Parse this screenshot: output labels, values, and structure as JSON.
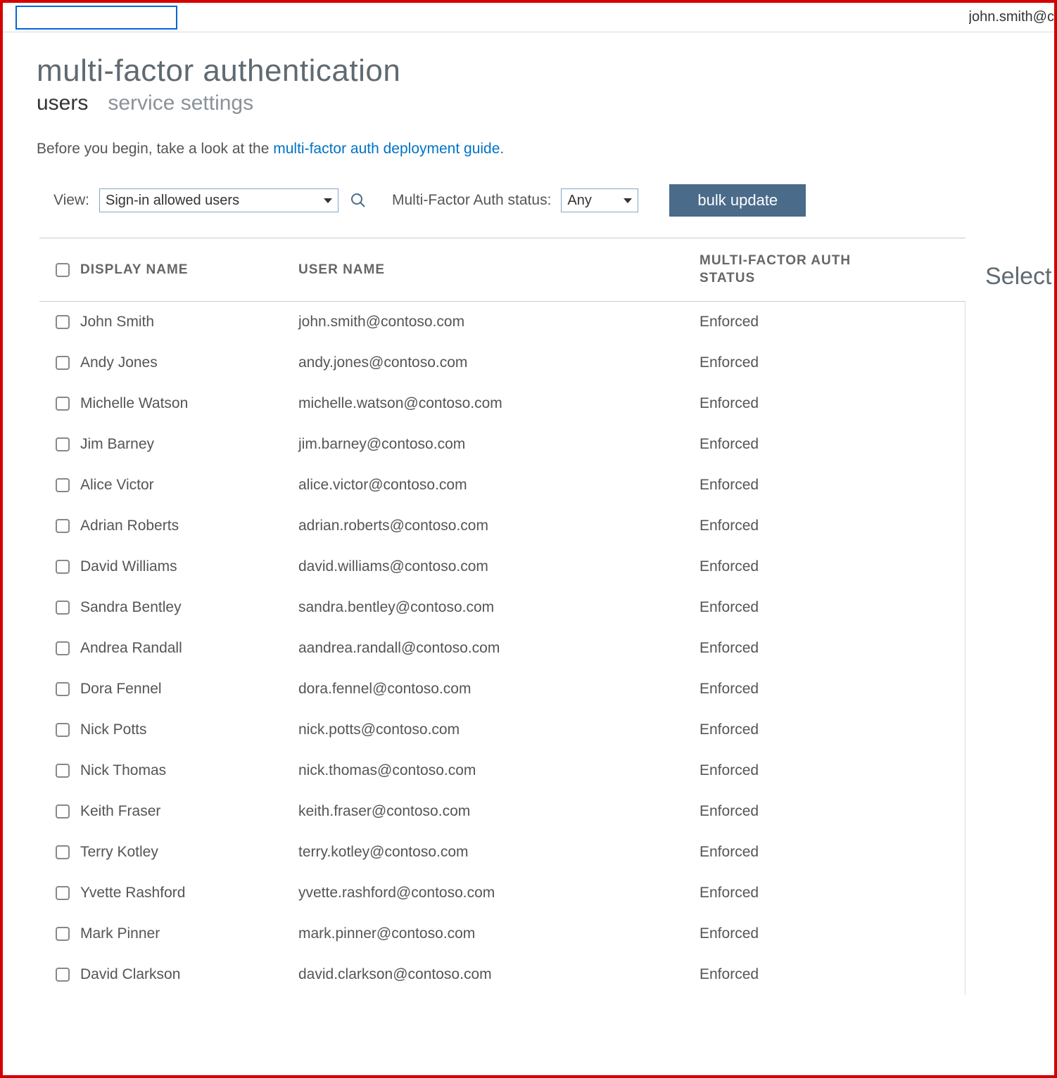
{
  "header": {
    "user_partial": "john.smith@c"
  },
  "page": {
    "title": "multi-factor authentication",
    "tabs": {
      "users": "users",
      "settings": "service settings"
    },
    "intro_prefix": "Before you begin, take a look at the ",
    "intro_link": "multi-factor auth deployment guide",
    "intro_suffix": "."
  },
  "controls": {
    "view_label": "View:",
    "view_value": "Sign-in allowed users",
    "status_label": "Multi-Factor Auth status:",
    "status_value": "Any",
    "bulk_label": "bulk update"
  },
  "columns": {
    "display_name": "DISPLAY NAME",
    "user_name": "USER NAME",
    "mfa_status": "MULTI-FACTOR AUTH STATUS"
  },
  "side": {
    "title": "Select"
  },
  "rows": [
    {
      "display": "John Smith",
      "user": "john.smith@contoso.com",
      "status": "Enforced"
    },
    {
      "display": "Andy Jones",
      "user": "andy.jones@contoso.com",
      "status": "Enforced"
    },
    {
      "display": "Michelle Watson",
      "user": "michelle.watson@contoso.com",
      "status": "Enforced"
    },
    {
      "display": "Jim Barney",
      "user": "jim.barney@contoso.com",
      "status": "Enforced"
    },
    {
      "display": "Alice Victor",
      "user": "alice.victor@contoso.com",
      "status": "Enforced"
    },
    {
      "display": "Adrian Roberts",
      "user": "adrian.roberts@contoso.com",
      "status": "Enforced"
    },
    {
      "display": "David Williams",
      "user": "david.williams@contoso.com",
      "status": "Enforced"
    },
    {
      "display": "Sandra Bentley",
      "user": "sandra.bentley@contoso.com",
      "status": "Enforced"
    },
    {
      "display": "Andrea Randall",
      "user": "aandrea.randall@contoso.com",
      "status": "Enforced"
    },
    {
      "display": "Dora Fennel",
      "user": "dora.fennel@contoso.com",
      "status": "Enforced"
    },
    {
      "display": "Nick Potts",
      "user": "nick.potts@contoso.com",
      "status": "Enforced"
    },
    {
      "display": "Nick Thomas",
      "user": "nick.thomas@contoso.com",
      "status": "Enforced"
    },
    {
      "display": "Keith Fraser",
      "user": "keith.fraser@contoso.com",
      "status": "Enforced"
    },
    {
      "display": "Terry Kotley",
      "user": "terry.kotley@contoso.com",
      "status": "Enforced"
    },
    {
      "display": "Yvette Rashford",
      "user": "yvette.rashford@contoso.com",
      "status": "Enforced"
    },
    {
      "display": "Mark Pinner",
      "user": "mark.pinner@contoso.com",
      "status": "Enforced"
    },
    {
      "display": "David Clarkson",
      "user": "david.clarkson@contoso.com",
      "status": "Enforced"
    }
  ]
}
